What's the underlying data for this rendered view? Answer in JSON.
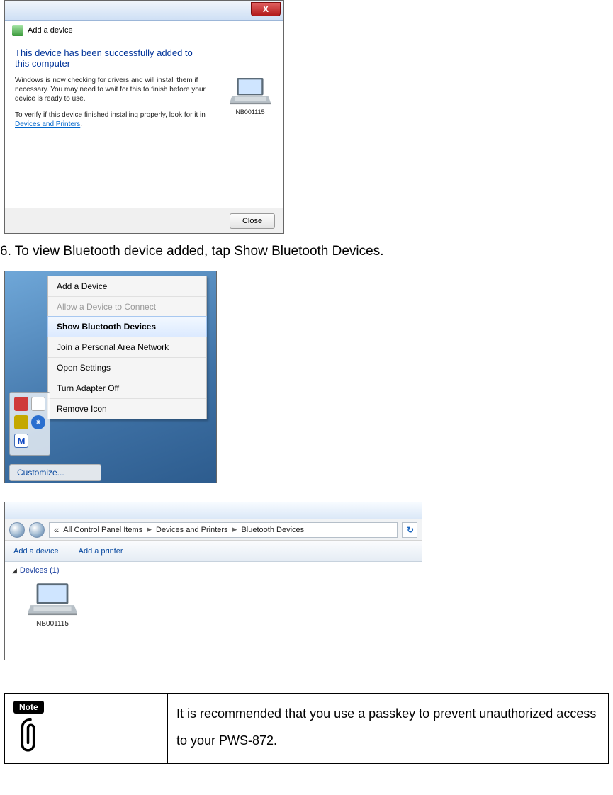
{
  "shot1": {
    "crumb_label": "Add a device",
    "close_glyph": "X",
    "heading": "This device has been successfully added to this computer",
    "para1": "Windows is now checking for drivers and will install them if necessary. You may need to wait for this to finish before your device is ready to use.",
    "para2_prefix": "To verify if this device finished installing properly, look for it in ",
    "link": "Devices and Printers",
    "para2_suffix": ".",
    "device_name": "NB001115",
    "close_btn": "Close"
  },
  "step6": "6. To view Bluetooth device added, tap Show Bluetooth Devices.",
  "shot2_menu": {
    "add": "Add a Device",
    "allow": "Allow a Device to Connect",
    "show": "Show Bluetooth Devices",
    "join": "Join a Personal Area Network",
    "open": "Open Settings",
    "off": "Turn Adapter Off",
    "remove": "Remove Icon"
  },
  "shot2_customize": "Customize...",
  "shot2_bt_glyph": "⁕",
  "shot2_m_glyph": "M",
  "shot3": {
    "addr_seg1": "All Control Panel Items",
    "addr_seg2": "Devices and Printers",
    "addr_seg3": "Bluetooth Devices",
    "tb_add_device": "Add a device",
    "tb_add_printer": "Add a printer",
    "section": "Devices (1)",
    "device_name": "NB001115"
  },
  "note": {
    "badge": "Note",
    "text": "It is recommended that you use a passkey to prevent unauthorized access to your PWS-872."
  }
}
